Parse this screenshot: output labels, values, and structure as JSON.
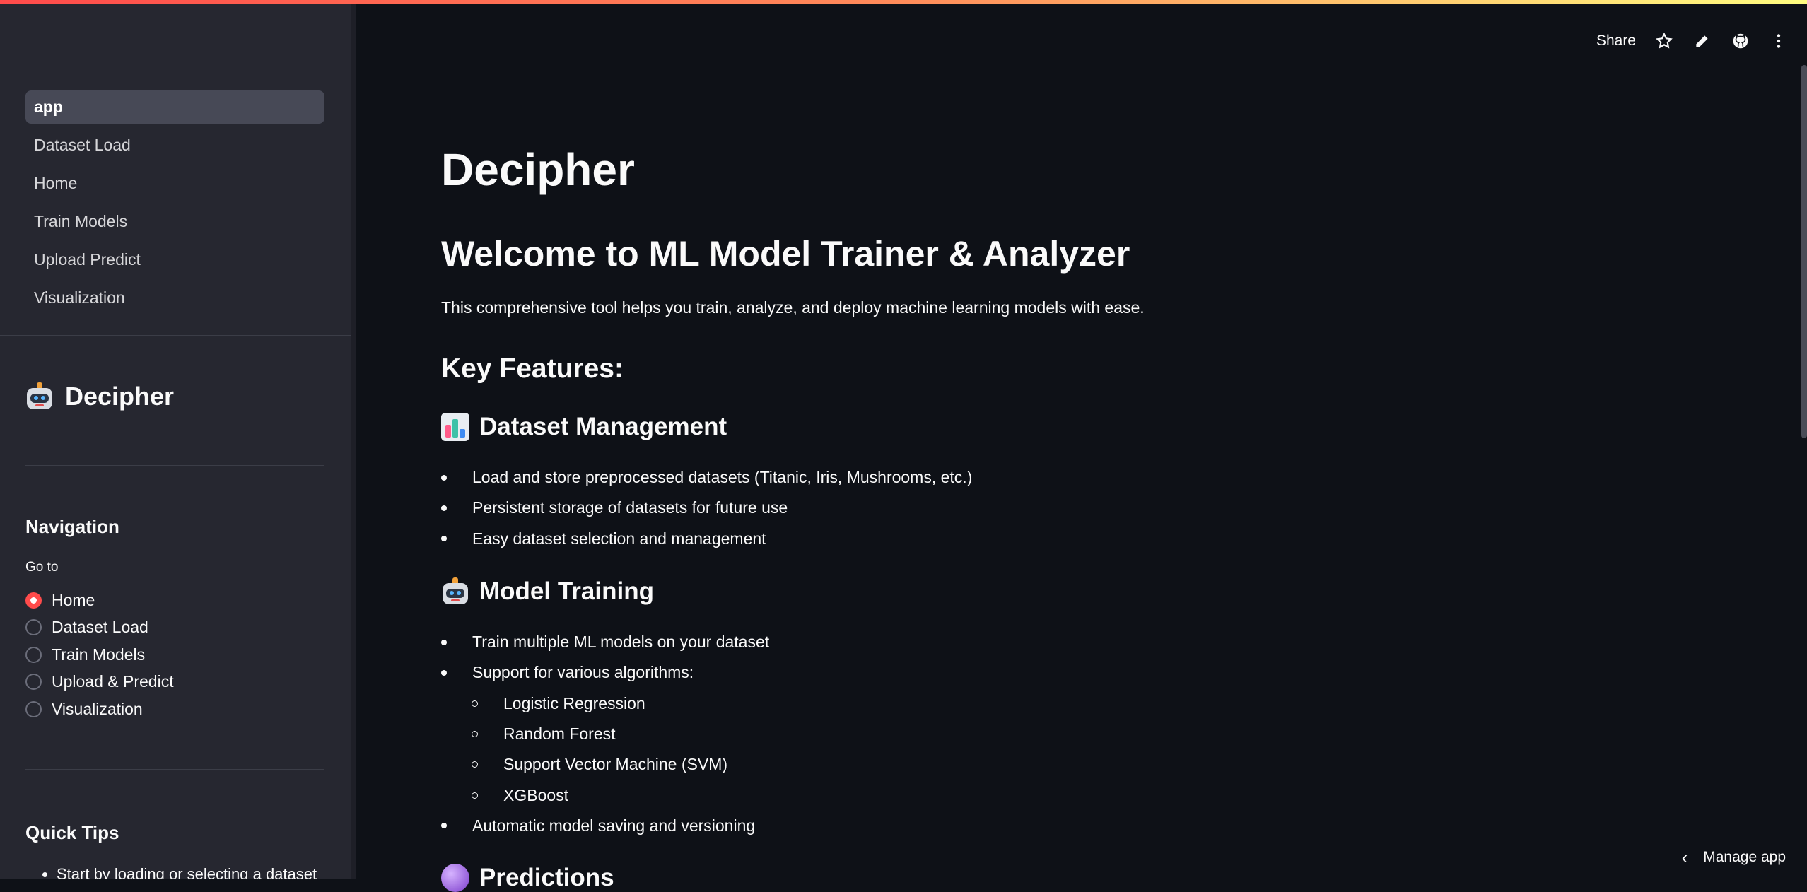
{
  "pages_nav": [
    "app",
    "Dataset Load",
    "Home",
    "Train Models",
    "Upload Predict",
    "Visualization"
  ],
  "sidebar": {
    "title": "Decipher",
    "navigation_heading": "Navigation",
    "goto_label": "Go to",
    "radio_options": [
      "Home",
      "Dataset Load",
      "Train Models",
      "Upload & Predict",
      "Visualization"
    ],
    "selected_option": "Home",
    "quick_tips_heading": "Quick Tips",
    "quick_tips": [
      "Start by loading or selecting a dataset"
    ]
  },
  "toolbar": {
    "share_label": "Share",
    "icons": [
      "star-icon",
      "pencil-icon",
      "github-icon",
      "more-vertical-icon"
    ]
  },
  "main": {
    "title": "Decipher",
    "welcome": "Welcome to ML Model Trainer & Analyzer",
    "intro": "This comprehensive tool helps you train, analyze, and deploy machine learning models with ease.",
    "key_features": "Key Features:",
    "sections": [
      {
        "icon": "bar-chart-emoji",
        "heading": "Dataset Management",
        "items": [
          "Load and store preprocessed datasets (Titanic, Iris, Mushrooms, etc.)",
          "Persistent storage of datasets for future use",
          "Easy dataset selection and management"
        ]
      },
      {
        "icon": "robot-emoji",
        "heading": "Model Training",
        "items": [
          "Train multiple ML models on your dataset",
          "Support for various algorithms:",
          "Logistic Regression",
          "Random Forest",
          "Support Vector Machine (SVM)",
          "XGBoost",
          "Automatic model saving and versioning"
        ]
      },
      {
        "icon": "crystal-ball-emoji",
        "heading": "Predictions"
      }
    ]
  },
  "footer": {
    "manage_app": "Manage app"
  },
  "colors": {
    "accent": "#ff4b4b",
    "background": "#0e1117",
    "sidebar": "#262730"
  }
}
